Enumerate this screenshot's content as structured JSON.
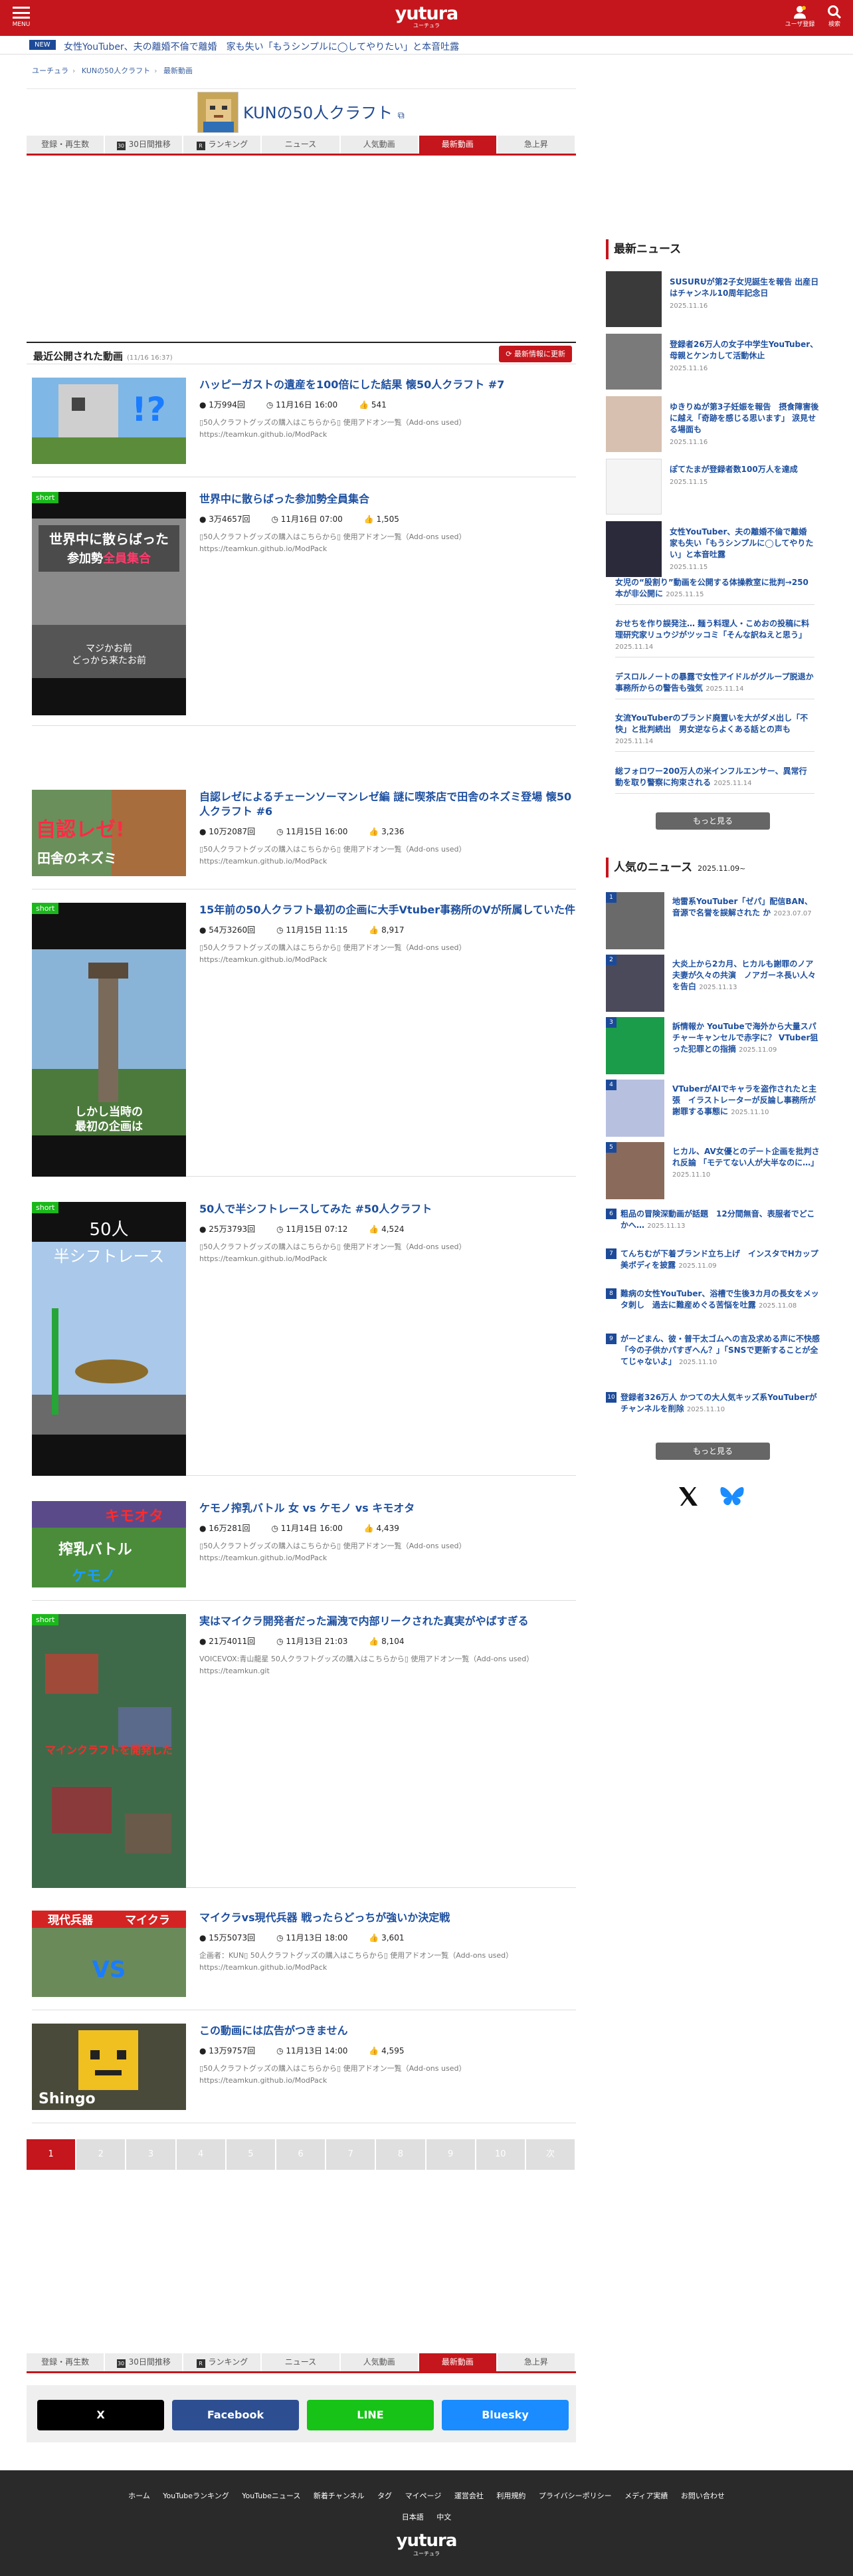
{
  "header": {
    "menu_label": "MENU",
    "logo": "yutura",
    "logo_sub": "ユーチュラ",
    "user_reg_label": "ユーザ登録",
    "search_label": "検索"
  },
  "ticker": {
    "badge": "NEW",
    "text": "女性YouTuber、夫の離婚不倫で離婚　家も失い「もうシンプルに◯してやりたい」と本音吐露"
  },
  "breadcrumb": [
    "ユーチュラ",
    "KUNの50人クラフト",
    "最新動画"
  ],
  "channel": {
    "title": "KUNの50人クラフト"
  },
  "tabs": [
    {
      "label": "登録・再生数",
      "icon": ""
    },
    {
      "label": "30日間推移",
      "icon": "30"
    },
    {
      "label": "ランキング",
      "icon": "R"
    },
    {
      "label": "ニュース",
      "icon": ""
    },
    {
      "label": "人気動画",
      "icon": ""
    },
    {
      "label": "最新動画",
      "icon": "",
      "active": true
    },
    {
      "label": "急上昇",
      "icon": ""
    }
  ],
  "list": {
    "heading": "最近公開された動画",
    "updated": "(11/16 16:37)",
    "refresh_label": "最新情報に更新"
  },
  "videos": [
    {
      "title": "ハッピーガストの遺産を100倍にした結果 懐50人クラフト #7",
      "views": "1万994回",
      "date": "11月16日 16:00",
      "likes": "541",
      "desc": "▯50人クラフトグッズの購入はこちらから▯ 使用アドオン一覧（Add-ons used）https://teamkun.github.io/ModPack",
      "short": false
    },
    {
      "title": "世界中に散らばった参加勢全員集合",
      "views": "3万4657回",
      "date": "11月16日 07:00",
      "likes": "1,505",
      "desc": "▯50人クラフトグッズの購入はこちらから▯ 使用アドオン一覧（Add-ons used）https://teamkun.github.io/ModPack",
      "short": true
    },
    {
      "title": "自認レゼによるチェーンソーマンレゼ編 謎に喫茶店で田舎のネズミ登場 懐50人クラフト #6",
      "views": "10万2087回",
      "date": "11月15日 16:00",
      "likes": "3,236",
      "desc": "▯50人クラフトグッズの購入はこちらから▯ 使用アドオン一覧（Add-ons used）https://teamkun.github.io/ModPack",
      "short": false
    },
    {
      "title": "15年前の50人クラフト最初の企画に大手Vtuber事務所のVが所属していた件",
      "views": "54万3260回",
      "date": "11月15日 11:15",
      "likes": "8,917",
      "desc": "▯50人クラフトグッズの購入はこちらから▯ 使用アドオン一覧（Add-ons used）https://teamkun.github.io/ModPack",
      "short": true
    },
    {
      "title": "50人で半シフトレースしてみた #50人クラフト",
      "views": "25万3793回",
      "date": "11月15日 07:12",
      "likes": "4,524",
      "desc": "▯50人クラフトグッズの購入はこちらから▯ 使用アドオン一覧（Add-ons used）https://teamkun.github.io/ModPack",
      "short": true
    },
    {
      "title": "ケモノ搾乳バトル 女 vs ケモノ vs キモオタ",
      "views": "16万281回",
      "date": "11月14日 16:00",
      "likes": "4,439",
      "desc": "▯50人クラフトグッズの購入はこちらから▯ 使用アドオン一覧（Add-ons used）https://teamkun.github.io/ModPack",
      "short": false
    },
    {
      "title": "実はマイクラ開発者だった漏洩で内部リークされた真実がやばすぎる",
      "views": "21万4011回",
      "date": "11月13日 21:03",
      "likes": "8,104",
      "desc": "VOICEVOX:青山龍星 50人クラフトグッズの購入はこちらから▯ 使用アドオン一覧（Add-ons used）https://teamkun.git",
      "short": true
    },
    {
      "title": "マイクラvs現代兵器 戦ったらどっちが強いか決定戦",
      "views": "15万5073回",
      "date": "11月13日 18:00",
      "likes": "3,601",
      "desc": "企画者：KUN▯ 50人クラフトグッズの購入はこちらから▯ 使用アドオン一覧（Add-ons used）https://teamkun.github.io/ModPack",
      "short": false
    },
    {
      "title": "この動画には広告がつきません",
      "views": "13万9757回",
      "date": "11月13日 14:00",
      "likes": "4,595",
      "desc": "▯50人クラフトグッズの購入はこちらから▯ 使用アドオン一覧（Add-ons used）https://teamkun.github.io/ModPack",
      "short": false
    }
  ],
  "pager": [
    "1",
    "2",
    "3",
    "4",
    "5",
    "6",
    "7",
    "8",
    "9",
    "10",
    "次"
  ],
  "share": {
    "x": "X",
    "facebook": "Facebook",
    "line": "LINE",
    "bluesky": "Bluesky"
  },
  "latest_news": {
    "heading": "最新ニュース",
    "items": [
      {
        "title": "SUSURUが第2子女児誕生を報告 出産日はチャンネル10周年記念日",
        "date": "2025.11.16"
      },
      {
        "title": "登録者26万人の女子中学生YouTuber、母親とケンカして活動休止",
        "date": "2025.11.16"
      },
      {
        "title": "ゆきりぬが第3子妊娠を報告　摂食障害後に越え「奇跡を感じる思います」 涙見せる場面も",
        "date": "2025.11.16"
      },
      {
        "title": "ぽてたまが登録者数100万人を達成",
        "date": "2025.11.15"
      },
      {
        "title": "女性YouTuber、夫の離婚不倫で離婚　家も失い「もうシンプルに◯してやりたい」と本音吐露",
        "date": "2025.11.15"
      }
    ],
    "text_items": [
      {
        "title": "女児の“股割り”動画を公開する体操教室に批判→250本が非公開に",
        "date": "2025.11.15"
      },
      {
        "title": "おせちを作り誤発注… 麺う料理人・こめおの投稿に料理研究家リュウジがツッコミ「そんな訳ねえと思う」",
        "date": "2025.11.14"
      },
      {
        "title": "デスロルノートの暴露で女性アイドルがグループ脱退か　事務所からの警告も強気",
        "date": "2025.11.14"
      },
      {
        "title": "女流YouTuberのブランド廃置いを大がダメ出し「不快」と批判続出　男女逆ならよくある話との声も",
        "date": "2025.11.14"
      },
      {
        "title": "総フォロワー200万人の米インフルエンサー、異常行動を取り警察に拘束される",
        "date": "2025.11.14"
      }
    ],
    "more_label": "もっと見る"
  },
  "popular_news": {
    "heading": "人気のニュース",
    "since": "2025.11.09~",
    "items": [
      {
        "num": "1",
        "title": "地雷系YouTuber「ゼパ」配信BAN、音源で名誉を誤解された か",
        "date": "2023.07.07"
      },
      {
        "num": "2",
        "title": "大炎上から2カ月、ヒカルも謝罪のノア夫妻が久々の共演　ノアガーネ長い人々を告白",
        "date": "2025.11.13"
      },
      {
        "num": "3",
        "title": "訴情報か YouTubeで海外から大量スパチャーキャンセルで赤字に？ VTuber狙った犯罪との指摘",
        "date": "2025.11.09"
      },
      {
        "num": "4",
        "title": "VTuberがAIでキャラを盗作されたと主張　イラストレーターが反論し事務所が謝罪する事態に",
        "date": "2025.11.10"
      },
      {
        "num": "5",
        "title": "ヒカル、AV女優とのデート企画を批判され反論 「モテてない人が大半なのに…」",
        "date": "2025.11.10"
      }
    ],
    "text_items": [
      {
        "num": "6",
        "title": "粗品の冒険深動画が話題　12分間無音、表服者でどこかへ…",
        "date": "2025.11.13"
      },
      {
        "num": "7",
        "title": "てんちむが下着ブランド立ち上げ　インスタでHカップ美ボディを披露",
        "date": "2025.11.09"
      },
      {
        "num": "8",
        "title": "難病の女性YouTuber、浴槽で生後3カ月の長女をメッタ刺し　過去に難産めぐる苦悩を吐露",
        "date": "2025.11.08"
      },
      {
        "num": "9",
        "title": "がーどまん、彼・普干太ゴムへの言及求める声に不快感 「今の子供かパすぎへん？」「SNSで更新することが全てじゃないよ」",
        "date": "2025.11.10"
      },
      {
        "num": "10",
        "title": "登録者326万人 かつての大人気キッズ系YouTuberがチャンネルを削除",
        "date": "2025.11.10"
      }
    ],
    "more_label": "もっと見る"
  },
  "footer": {
    "links": [
      "ホーム",
      "YouTubeランキング",
      "YouTubeニュース",
      "新着チャンネル",
      "タグ",
      "マイページ",
      "運営会社",
      "利用規約",
      "プライバシーポリシー",
      "メディア実績",
      "お問い合わせ"
    ],
    "langs": [
      "日本語",
      "中文"
    ],
    "logo": "yutura",
    "logo_sub": "ユーチュラ"
  },
  "colors": {
    "brand": "#c4161c",
    "link": "#1d4f9f",
    "short_badge": "#1bb81b"
  }
}
